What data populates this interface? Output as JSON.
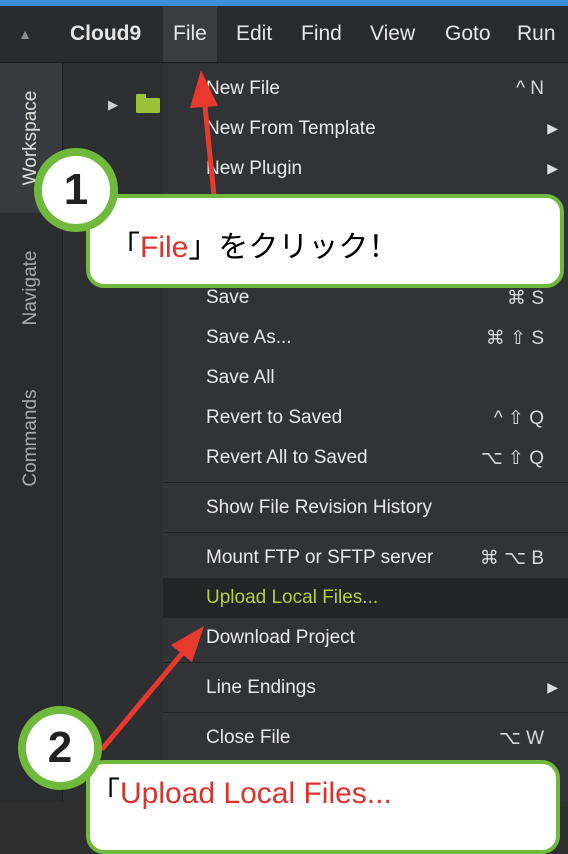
{
  "menubar": {
    "brand": "Cloud9",
    "items": [
      "File",
      "Edit",
      "Find",
      "View",
      "Goto",
      "Run"
    ]
  },
  "sidebar": {
    "tabs": [
      "Workspace",
      "Navigate",
      "Commands"
    ]
  },
  "file_menu": {
    "items": [
      {
        "label": "New File",
        "shortcut": "^ N"
      },
      {
        "label": "New From Template",
        "submenu": true
      },
      {
        "label": "New Plugin",
        "submenu": true
      },
      {
        "label": "Save",
        "shortcut": "⌘ S"
      },
      {
        "label": "Save As...",
        "shortcut": "⌘ ⇧ S"
      },
      {
        "label": "Save All"
      },
      {
        "label": "Revert to Saved",
        "shortcut": "^ ⇧ Q"
      },
      {
        "label": "Revert All to Saved",
        "shortcut": "⌥ ⇧ Q"
      },
      {
        "label": "Show File Revision History"
      },
      {
        "label": "Mount FTP or SFTP server",
        "shortcut": "⌘ ⌥ B"
      },
      {
        "label": "Upload Local Files...",
        "highlighted": true
      },
      {
        "label": "Download Project"
      },
      {
        "label": "Line Endings",
        "submenu": true
      },
      {
        "label": "Close File",
        "shortcut": "⌥ W"
      }
    ]
  },
  "annotations": {
    "step1": {
      "number": "1",
      "open_quote": "「",
      "target": "File",
      "close_text": "」をクリック！"
    },
    "step2": {
      "number": "2",
      "open_quote": "「",
      "target": "Upload Local Files..."
    }
  },
  "icons": {
    "collapse": "collapse-up-icon",
    "tree_expand": "triangle-right-icon",
    "folder": "folder-icon",
    "submenu": "chevron-right-icon"
  },
  "colors": {
    "accent_green": "#6fba3c",
    "highlight_text": "#b4cf3e",
    "annotation_red": "#d9332c",
    "arrow_red": "#e8392f"
  }
}
